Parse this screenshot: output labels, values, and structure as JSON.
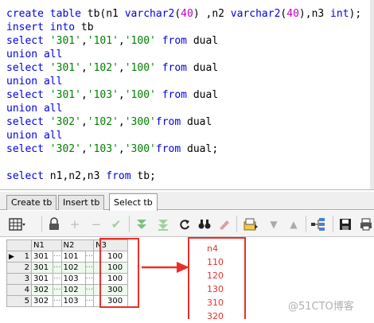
{
  "editor": {
    "lines": [
      [
        [
          "kw",
          "create table "
        ],
        [
          "id",
          "tb"
        ],
        [
          "p",
          "("
        ],
        [
          "id",
          "n1 "
        ],
        [
          "kw",
          "varchar2"
        ],
        [
          "p",
          "("
        ],
        [
          "num",
          "40"
        ],
        [
          "p",
          ") ,"
        ],
        [
          "id",
          "n2 "
        ],
        [
          "kw",
          "varchar2"
        ],
        [
          "p",
          "("
        ],
        [
          "num",
          "40"
        ],
        [
          "p",
          "),"
        ],
        [
          "id",
          "n3 "
        ],
        [
          "kw",
          "int"
        ],
        [
          "p",
          ");"
        ]
      ],
      [
        [
          "kw",
          "insert into "
        ],
        [
          "id",
          "tb"
        ]
      ],
      [
        [
          "kw",
          "select "
        ],
        [
          "str",
          "'301'"
        ],
        [
          "p",
          ","
        ],
        [
          "str",
          "'101'"
        ],
        [
          "p",
          ","
        ],
        [
          "str",
          "'100' "
        ],
        [
          "kw",
          "from "
        ],
        [
          "id",
          "dual"
        ]
      ],
      [
        [
          "kw",
          "union all"
        ]
      ],
      [
        [
          "kw",
          "select "
        ],
        [
          "str",
          "'301'"
        ],
        [
          "p",
          ","
        ],
        [
          "str",
          "'102'"
        ],
        [
          "p",
          ","
        ],
        [
          "str",
          "'100' "
        ],
        [
          "kw",
          "from "
        ],
        [
          "id",
          "dual"
        ]
      ],
      [
        [
          "kw",
          "union all"
        ]
      ],
      [
        [
          "kw",
          "select "
        ],
        [
          "str",
          "'301'"
        ],
        [
          "p",
          ","
        ],
        [
          "str",
          "'103'"
        ],
        [
          "p",
          ","
        ],
        [
          "str",
          "'100' "
        ],
        [
          "kw",
          "from "
        ],
        [
          "id",
          "dual"
        ]
      ],
      [
        [
          "kw",
          "union all"
        ]
      ],
      [
        [
          "kw",
          "select "
        ],
        [
          "str",
          "'302'"
        ],
        [
          "p",
          ","
        ],
        [
          "str",
          "'102'"
        ],
        [
          "p",
          ","
        ],
        [
          "str",
          "'300'"
        ],
        [
          "kw",
          "from "
        ],
        [
          "id",
          "dual"
        ]
      ],
      [
        [
          "kw",
          "union all"
        ]
      ],
      [
        [
          "kw",
          "select "
        ],
        [
          "str",
          "'302'"
        ],
        [
          "p",
          ","
        ],
        [
          "str",
          "'103'"
        ],
        [
          "p",
          ","
        ],
        [
          "str",
          "'300'"
        ],
        [
          "kw",
          "from "
        ],
        [
          "id",
          "dual"
        ],
        [
          "p",
          ";"
        ]
      ],
      [],
      [
        [
          "kw",
          "select "
        ],
        [
          "id",
          "n1"
        ],
        [
          "p",
          ","
        ],
        [
          "id",
          "n2"
        ],
        [
          "p",
          ","
        ],
        [
          "id",
          "n3 "
        ],
        [
          "kw",
          "from "
        ],
        [
          "id",
          "tb"
        ],
        [
          "p",
          ";"
        ]
      ]
    ]
  },
  "tabs": [
    {
      "label": "Create tb"
    },
    {
      "label": "Insert tb"
    },
    {
      "label": "Select tb"
    }
  ],
  "toolbar": {
    "icons": [
      "grid-icon",
      "lock-icon",
      "add-icon",
      "remove-icon",
      "check-icon",
      "filter-down-icon",
      "filter-clear-icon",
      "refresh-icon",
      "search-icon",
      "clear-icon",
      "export-icon",
      "next-icon",
      "prev-icon",
      "tree-icon",
      "save-icon",
      "print-icon"
    ]
  },
  "grid": {
    "columns": [
      "N1",
      "N2",
      "N3"
    ],
    "rows": [
      {
        "num": "1",
        "n1": "301",
        "n2": "101",
        "n3": "100"
      },
      {
        "num": "2",
        "n1": "301",
        "n2": "102",
        "n3": "100"
      },
      {
        "num": "3",
        "n1": "301",
        "n2": "103",
        "n3": "100"
      },
      {
        "num": "4",
        "n1": "302",
        "n2": "102",
        "n3": "300"
      },
      {
        "num": "5",
        "n1": "302",
        "n2": "103",
        "n3": "300"
      }
    ],
    "dots": "···"
  },
  "annotation": {
    "header": "n4",
    "values": [
      "110",
      "120",
      "130",
      "310",
      "320"
    ]
  },
  "watermark": "@51CTO博客",
  "colors": {
    "highlight": "#e8302a",
    "keyword": "#0000e6",
    "string": "#008000",
    "number": "#c000c0"
  }
}
